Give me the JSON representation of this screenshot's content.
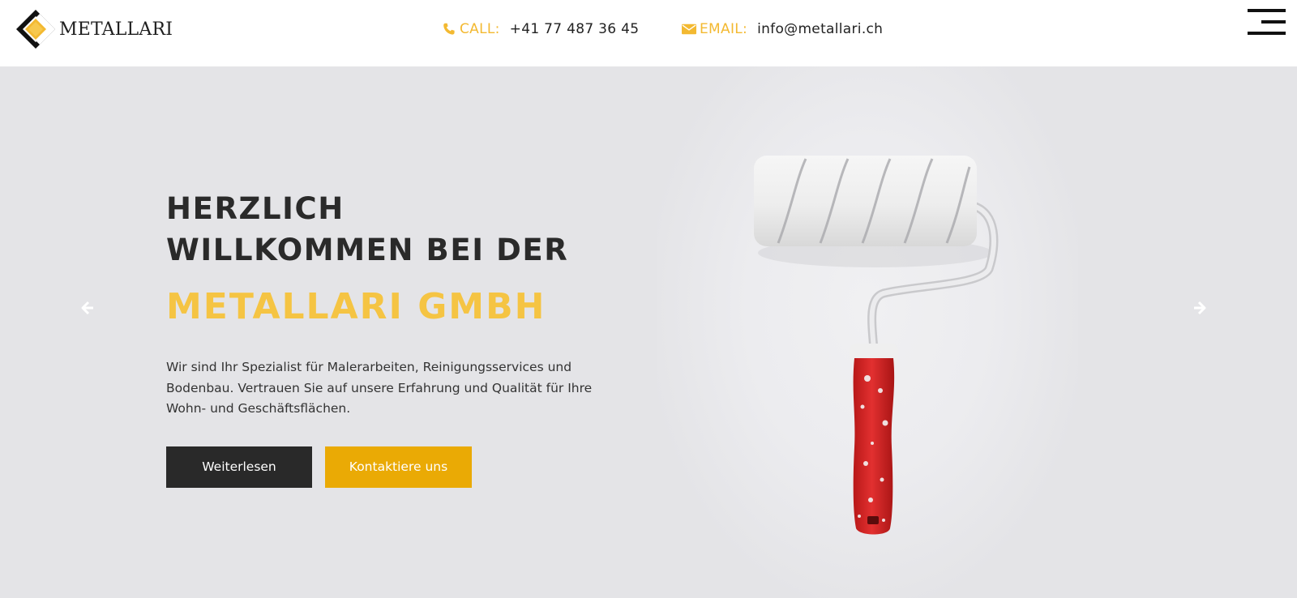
{
  "header": {
    "logo_text": "METALLARI",
    "phone_label": "CALL:",
    "phone_value": "+41 77 487 36 45",
    "email_label": "EMAIL:",
    "email_value": "info@metallari.ch",
    "icons": {
      "phone": "phone-icon",
      "email": "envelope-icon",
      "menu": "hamburger-menu-icon"
    }
  },
  "hero": {
    "title_line1": "HERZLICH",
    "title_line2": "WILLKOMMEN BEI DER",
    "brand": "METALLARI GMBH",
    "description": "Wir sind Ihr Spezialist für Malerarbeiten, Reinigungsservices und Bodenbau. Vertrauen Sie auf unsere Erfahrung und Qualität für Ihre Wohn- und Geschäftsflächen.",
    "primary_button": "Weiterlesen",
    "secondary_button": "Kontaktiere uns",
    "icons": {
      "prev": "arrow-left-icon",
      "next": "arrow-right-icon",
      "image": "paint-roller-image"
    }
  },
  "colors": {
    "accent": "#f3b931",
    "button_yellow": "#eaaa05",
    "button_dark": "#292929",
    "hero_bg": "#e4e4e7",
    "heading": "#2a2a2a"
  }
}
